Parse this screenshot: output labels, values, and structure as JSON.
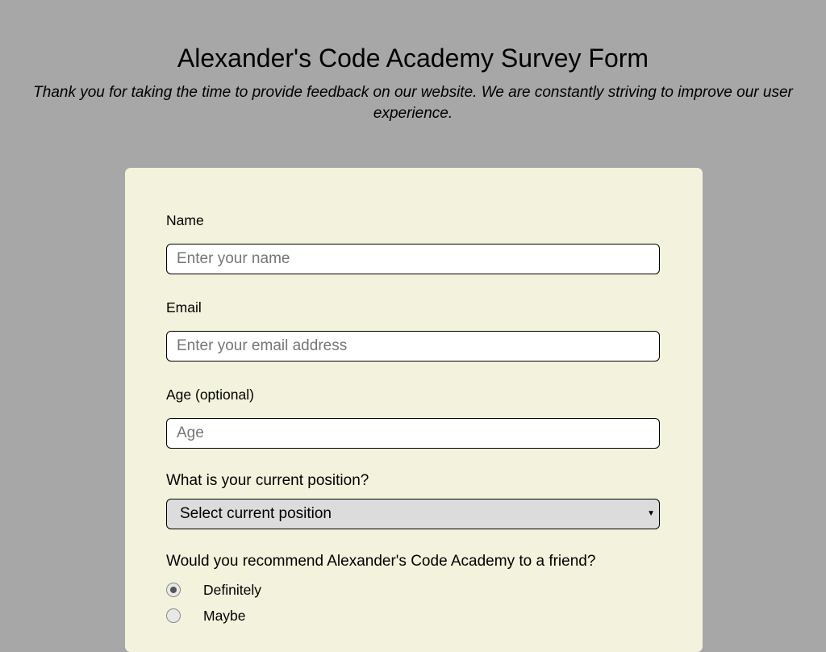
{
  "header": {
    "title": "Alexander's Code Academy Survey Form",
    "description": "Thank you for taking the time to provide feedback on our website. We are constantly striving to improve our user experience."
  },
  "form": {
    "name": {
      "label": "Name",
      "placeholder": "Enter your name",
      "value": ""
    },
    "email": {
      "label": "Email",
      "placeholder": "Enter your email address",
      "value": ""
    },
    "age": {
      "label": "Age (optional)",
      "placeholder": "Age",
      "value": ""
    },
    "position": {
      "question": "What is your current position?",
      "selected": "Select current position"
    },
    "recommend": {
      "question": "Would you recommend Alexander's Code Academy to a friend?",
      "options": [
        {
          "label": "Definitely",
          "checked": true
        },
        {
          "label": "Maybe",
          "checked": false
        }
      ]
    }
  },
  "colors": {
    "page_background": "#a7a7a7",
    "card_background": "#f3f3dd",
    "select_background": "#dcdcdc"
  }
}
